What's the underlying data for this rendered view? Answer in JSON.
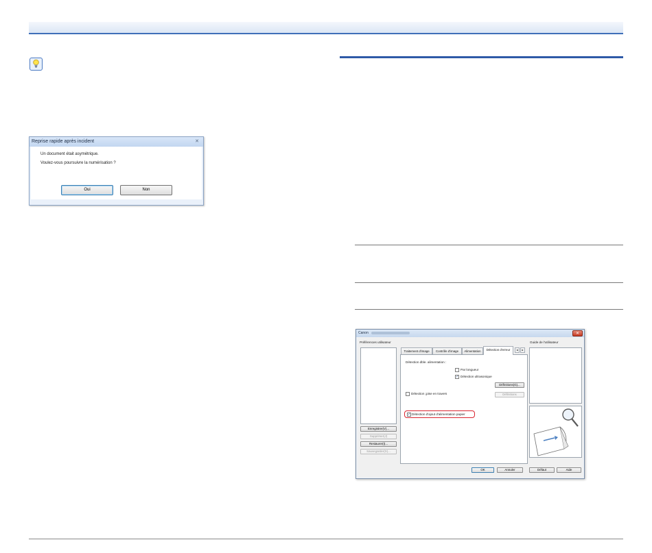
{
  "dialog1": {
    "title": "Reprise rapide après incident",
    "close_glyph": "✕",
    "message_line1": "Un document était asymétrique.",
    "message_line2": "Voulez-vous poursuivre la numérisation ?",
    "yes_button": "Oui",
    "no_button": "Non"
  },
  "dialog2": {
    "title": "Canon",
    "close_glyph": "✕",
    "left_panel_label": "Préférences utilisateur",
    "left_buttons": [
      "Enregistrer(V)...",
      "Supprimer(J)",
      "Restaurer(I)...",
      "Sauvegarder(X)..."
    ],
    "tabs": [
      "Traitement d'image",
      "Contrôle d'image",
      "Alimentation",
      "Détection d'erreur"
    ],
    "tab_scroll_left": "◂",
    "tab_scroll_right": "▸",
    "tab_content": {
      "group_label": "Détection dble. alimentation :",
      "by_length_label": "Par longueur",
      "by_length_checked": false,
      "ultrasonic_label": "Détection ultrasonique",
      "ultrasonic_checked": true,
      "settings_button": "Définitions(G)...",
      "skew_label": "Détection ¡pise en travers",
      "skew_checked": false,
      "skew_settings_button": "Définitions",
      "paper_feed_label": "Détection d'ajout d'alimentation papier",
      "paper_feed_checked": true
    },
    "guide_label": "Guide de l'utilisateur",
    "bottom_buttons": [
      "OK",
      "Annuler",
      "Défaut",
      "Aide"
    ],
    "check_glyph": "✓"
  },
  "colors": {
    "accent_blue": "#2e5aa7",
    "highlight_red": "#d9232e"
  }
}
